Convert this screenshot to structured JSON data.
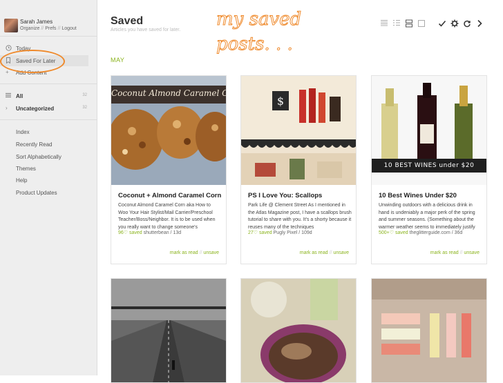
{
  "user": {
    "name": "Sarah James",
    "organize": "Organize",
    "prefs": "Prefs",
    "logout": "Logout",
    "sep": "//"
  },
  "nav": {
    "today": "Today",
    "saved": "Saved For Later",
    "add": "Add Content",
    "all": {
      "label": "All",
      "count": "32"
    },
    "uncategorized": {
      "label": "Uncategorized",
      "count": "32"
    }
  },
  "links": [
    "Index",
    "Recently Read",
    "Sort Alphabetically",
    "Themes",
    "Help",
    "Product Updates"
  ],
  "header": {
    "title": "Saved",
    "subtitle": "Articles you have saved for later.",
    "annotation": "my saved posts. . ."
  },
  "section": {
    "month": "MAY"
  },
  "cards": [
    {
      "title": "Coconut + Almond Caramel Corn",
      "banner": "Coconut Almond Caramel Corn",
      "excerpt": "Coconut Almond Caramel Corn aka How to Woo Your Hair Stylist/Mail Carrier/Preschool Teacher/Boss/Neighbor.  It is to be used when you really want to change someone's",
      "saved": "96♡ saved",
      "source": "shutterbean / 13d",
      "mark": "mark as read",
      "sep": "//",
      "unsave": "unsave"
    },
    {
      "title": "PS I Love You: Scallops",
      "excerpt": "Park Life @ Clement Street As I mentioned in the Atlas Magazine post, I have a scallops brush tutorial to share with you. It's a shorty because it reuses many of the techniques",
      "saved": "27♡ saved",
      "source": "Pugly Pixel / 109d",
      "mark": "mark as read",
      "sep": "//",
      "unsave": "unsave"
    },
    {
      "title": "10 Best Wines Under $20",
      "banner": "10 BEST WINES under $20",
      "excerpt": "Unwinding outdoors with a delicious drink in hand is undeniably a major perk of the spring and summer seasons. (Something about the warmer weather seems to immediately justify",
      "saved": "500+♡ saved",
      "source": "theglitterguide.com / 36d",
      "mark": "mark as read",
      "sep": "//",
      "unsave": "unsave"
    }
  ],
  "colors": {
    "accent": "#8ab31c",
    "annotation": "#ef8a2c"
  }
}
